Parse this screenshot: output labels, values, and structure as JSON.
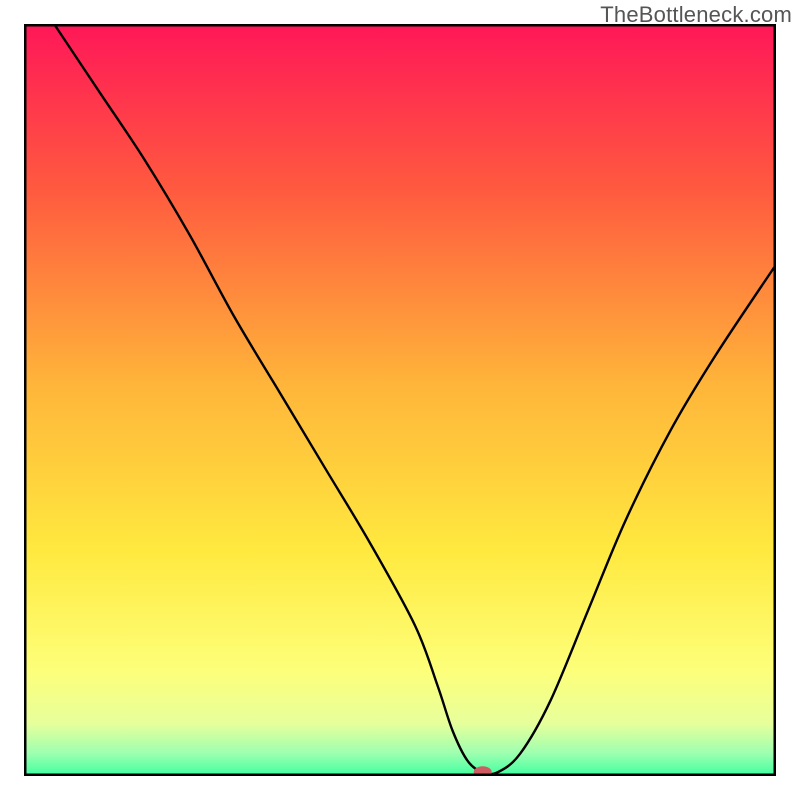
{
  "watermark": "TheBottleneck.com",
  "chart_data": {
    "type": "line",
    "title": "",
    "xlabel": "",
    "ylabel": "",
    "xlim": [
      0,
      100
    ],
    "ylim": [
      0,
      100
    ],
    "grid": false,
    "legend": false,
    "gradient_stops": [
      {
        "offset": 0,
        "color": "#ff1758"
      },
      {
        "offset": 22,
        "color": "#ff5a3f"
      },
      {
        "offset": 48,
        "color": "#ffb53a"
      },
      {
        "offset": 70,
        "color": "#ffe93f"
      },
      {
        "offset": 86,
        "color": "#fdff7a"
      },
      {
        "offset": 93,
        "color": "#e7ff9b"
      },
      {
        "offset": 97,
        "color": "#9dffb0"
      },
      {
        "offset": 100,
        "color": "#3fffa0"
      }
    ],
    "series": [
      {
        "name": "bottleneck-curve",
        "stroke": "#000000",
        "x": [
          4,
          10,
          16,
          22,
          28,
          34,
          40,
          46,
          52,
          55,
          57,
          59,
          61,
          63,
          66,
          70,
          75,
          80,
          86,
          92,
          100
        ],
        "y": [
          100,
          91,
          82,
          72,
          61,
          51,
          41,
          31,
          20,
          12,
          6,
          2,
          0.5,
          0.5,
          3,
          10,
          22,
          34,
          46,
          56,
          68
        ]
      }
    ],
    "marker": {
      "name": "selected-point",
      "x": 61,
      "y": 0.5,
      "color": "#cd5d63",
      "rx": 9,
      "ry": 6
    }
  }
}
